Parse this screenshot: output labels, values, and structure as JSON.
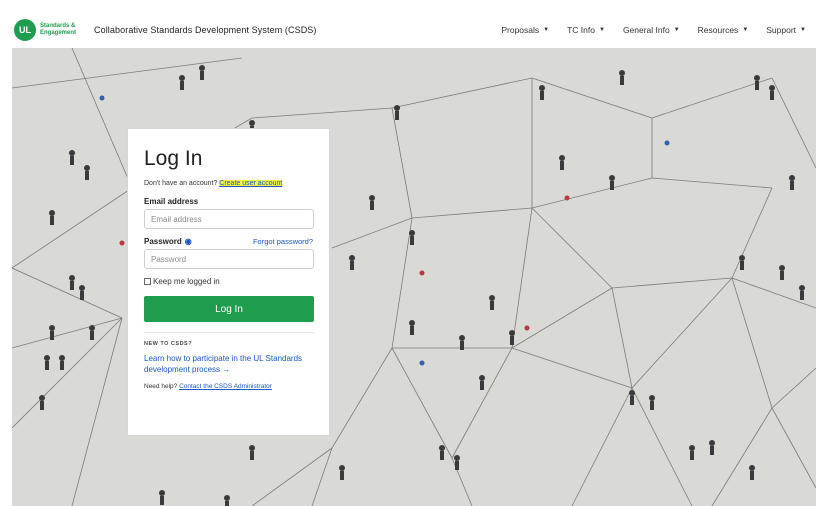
{
  "header": {
    "logo_mark": "UL",
    "logo_text": "Standards & Engagement",
    "app_title": "Collaborative Standards Development System (CSDS)",
    "nav": [
      {
        "label": "Proposals"
      },
      {
        "label": "TC Info"
      },
      {
        "label": "General Info"
      },
      {
        "label": "Resources"
      },
      {
        "label": "Support"
      }
    ]
  },
  "login": {
    "title": "Log In",
    "no_account_text": "Don't have an account? ",
    "create_link": "Create user account",
    "email_label": "Email address",
    "email_placeholder": "Email address",
    "password_label": "Password",
    "forgot_link": "Forgot password?",
    "password_placeholder": "Password",
    "keep_logged_in": "Keep me logged in",
    "login_button": "Log In",
    "new_heading": "NEW TO CSDS?",
    "learn_link": "Learn how to participate in the UL Standards development process →",
    "help_text": "Need help? ",
    "help_link": "Contact the CSDS Administrator"
  },
  "colors": {
    "brand_green": "#1e9d4f",
    "link_blue": "#1a56c4",
    "highlight": "#f3f24a"
  }
}
